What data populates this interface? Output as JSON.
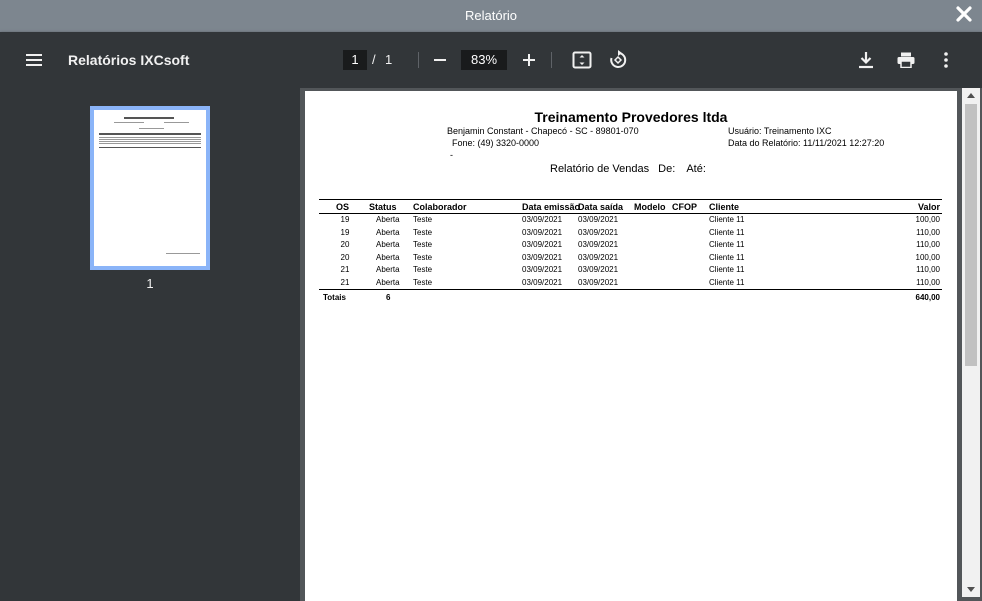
{
  "window": {
    "title": "Relatório"
  },
  "toolbar": {
    "menu_icon": "hamburger-menu-icon",
    "doc_title": "Relatórios IXCsoft",
    "current_page": "1",
    "page_separator": "/",
    "total_pages": "1",
    "zoom": "83%",
    "icons": [
      "zoom-out-icon",
      "zoom-in-icon",
      "fit-page-icon",
      "rotate-icon",
      "download-icon",
      "print-icon",
      "more-vert-icon"
    ]
  },
  "sidebar": {
    "thumbnail_label": "1"
  },
  "report": {
    "company": "Treinamento Provedores ltda",
    "address": "Benjamin Constant - Chapecó - SC - 89801-070",
    "phone": "Fone: (49) 3320-0000",
    "dash": "-",
    "user": "Usuário: Treinamento IXC",
    "report_date": "Data do Relatório: 11/11/2021 12:27:20",
    "title": "Relatório de Vendas",
    "from_label": "De:",
    "to_label": "Até:",
    "columns": [
      "OS",
      "Status",
      "Colaborador",
      "Data emissão",
      "Data saída",
      "Modelo",
      "CFOP",
      "Cliente",
      "Valor"
    ],
    "rows": [
      [
        "19",
        "Aberta",
        "Teste",
        "03/09/2021",
        "03/09/2021",
        "",
        "",
        "Cliente 11",
        "100,00"
      ],
      [
        "19",
        "Aberta",
        "Teste",
        "03/09/2021",
        "03/09/2021",
        "",
        "",
        "Cliente 11",
        "110,00"
      ],
      [
        "20",
        "Aberta",
        "Teste",
        "03/09/2021",
        "03/09/2021",
        "",
        "",
        "Cliente 11",
        "110,00"
      ],
      [
        "20",
        "Aberta",
        "Teste",
        "03/09/2021",
        "03/09/2021",
        "",
        "",
        "Cliente 11",
        "100,00"
      ],
      [
        "21",
        "Aberta",
        "Teste",
        "03/09/2021",
        "03/09/2021",
        "",
        "",
        "Cliente 11",
        "110,00"
      ],
      [
        "21",
        "Aberta",
        "Teste",
        "03/09/2021",
        "03/09/2021",
        "",
        "",
        "Cliente 11",
        "110,00"
      ]
    ],
    "totals_label": "Totais",
    "totals_count": "6",
    "totals_value": "640,00"
  }
}
